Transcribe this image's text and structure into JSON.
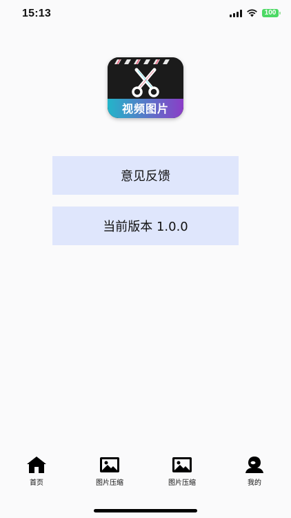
{
  "status_bar": {
    "time": "15:13",
    "battery": "100",
    "icons": [
      "signal-icon",
      "wifi-icon",
      "battery-icon"
    ]
  },
  "app_logo": {
    "text": "视频图片",
    "icon": "scissors-icon"
  },
  "menu": {
    "feedback_label": "意见反馈",
    "version_label": "当前版本 1.0.0",
    "button_color": "#dfe6fc"
  },
  "tab_bar": {
    "items": [
      {
        "label": "首页",
        "icon": "home-icon"
      },
      {
        "label": "图片压缩",
        "icon": "image-icon"
      },
      {
        "label": "图片压缩",
        "icon": "image-icon"
      },
      {
        "label": "我的",
        "icon": "user-icon"
      }
    ]
  },
  "colors": {
    "background": "#fafafb",
    "battery": "#4cd964",
    "logo_gradient_start": "#23b5c9",
    "logo_gradient_end": "#8b3dc7"
  }
}
